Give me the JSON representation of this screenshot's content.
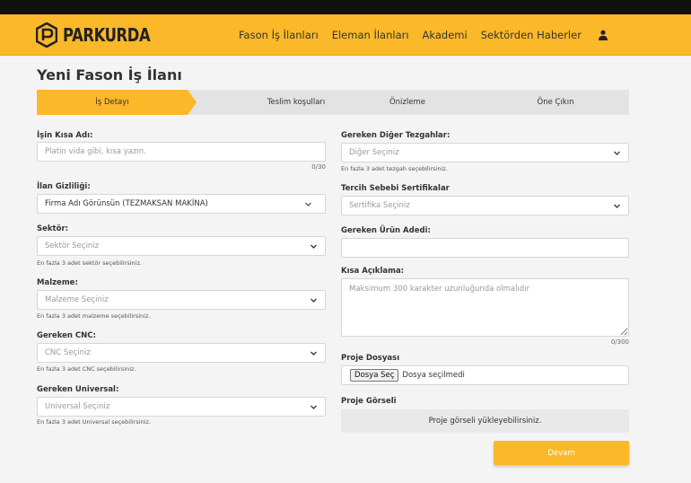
{
  "brand": {
    "name": "PARKURDA",
    "primary_color": "#fbb829"
  },
  "nav": {
    "items": [
      "Fason İş İlanları",
      "Eleman İlanları",
      "Akademi",
      "Sektörden Haberler"
    ],
    "user_icon": "user-icon"
  },
  "page": {
    "title": "Yeni Fason İş İlanı"
  },
  "steps": [
    "İş Detayı",
    "Teslim koşulları",
    "Önizleme",
    "Öne Çıkın"
  ],
  "left": {
    "job_name": {
      "label": "İşin Kısa Adı:",
      "placeholder": "Platin vida gibi, kısa yazın.",
      "counter": "0/30"
    },
    "privacy": {
      "label": "İlan Gizliliği:",
      "value": "Firma Adı Görünsün (TEZMAKSAN MAKİNA)"
    },
    "sector": {
      "label": "Sektör:",
      "placeholder": "Sektör Seçiniz",
      "hint": "En fazla 3 adet sektör seçebilirsiniz."
    },
    "material": {
      "label": "Malzeme:",
      "placeholder": "Malzeme Seçiniz",
      "hint": "En fazla 3 adet malzeme seçebilirsiniz."
    },
    "cnc": {
      "label": "Gereken CNC:",
      "placeholder": "CNC Seçiniz",
      "hint": "En fazla 3 adet CNC seçebilirsiniz."
    },
    "universal": {
      "label": "Gereken Universal:",
      "placeholder": "Universal Seçiniz",
      "hint": "En fazla 3 adet Universal seçebilirsiniz."
    }
  },
  "right": {
    "other_benches": {
      "label": "Gereken Diğer Tezgahlar:",
      "placeholder": "Diğer Seçiniz",
      "hint": "En fazla 3 adet tezgah seçebilirsiniz."
    },
    "certificates": {
      "label": "Tercih Sebebi Sertifikalar",
      "placeholder": "Sertifika Seçiniz"
    },
    "quantity": {
      "label": "Gereken Ürün Adedi:",
      "value": ""
    },
    "description": {
      "label": "Kısa Açıklama:",
      "placeholder": "Maksimum 300 karakter uzunluğunda olmalıdır",
      "counter": "0/300"
    },
    "project_file": {
      "label": "Proje Dosyası",
      "button": "Dosya Seç",
      "status": "Dosya seçilmedi"
    },
    "project_image": {
      "label": "Proje Görseli",
      "text": "Proje görseli yükleyebilirsiniz."
    }
  },
  "actions": {
    "continue": "Devam"
  }
}
